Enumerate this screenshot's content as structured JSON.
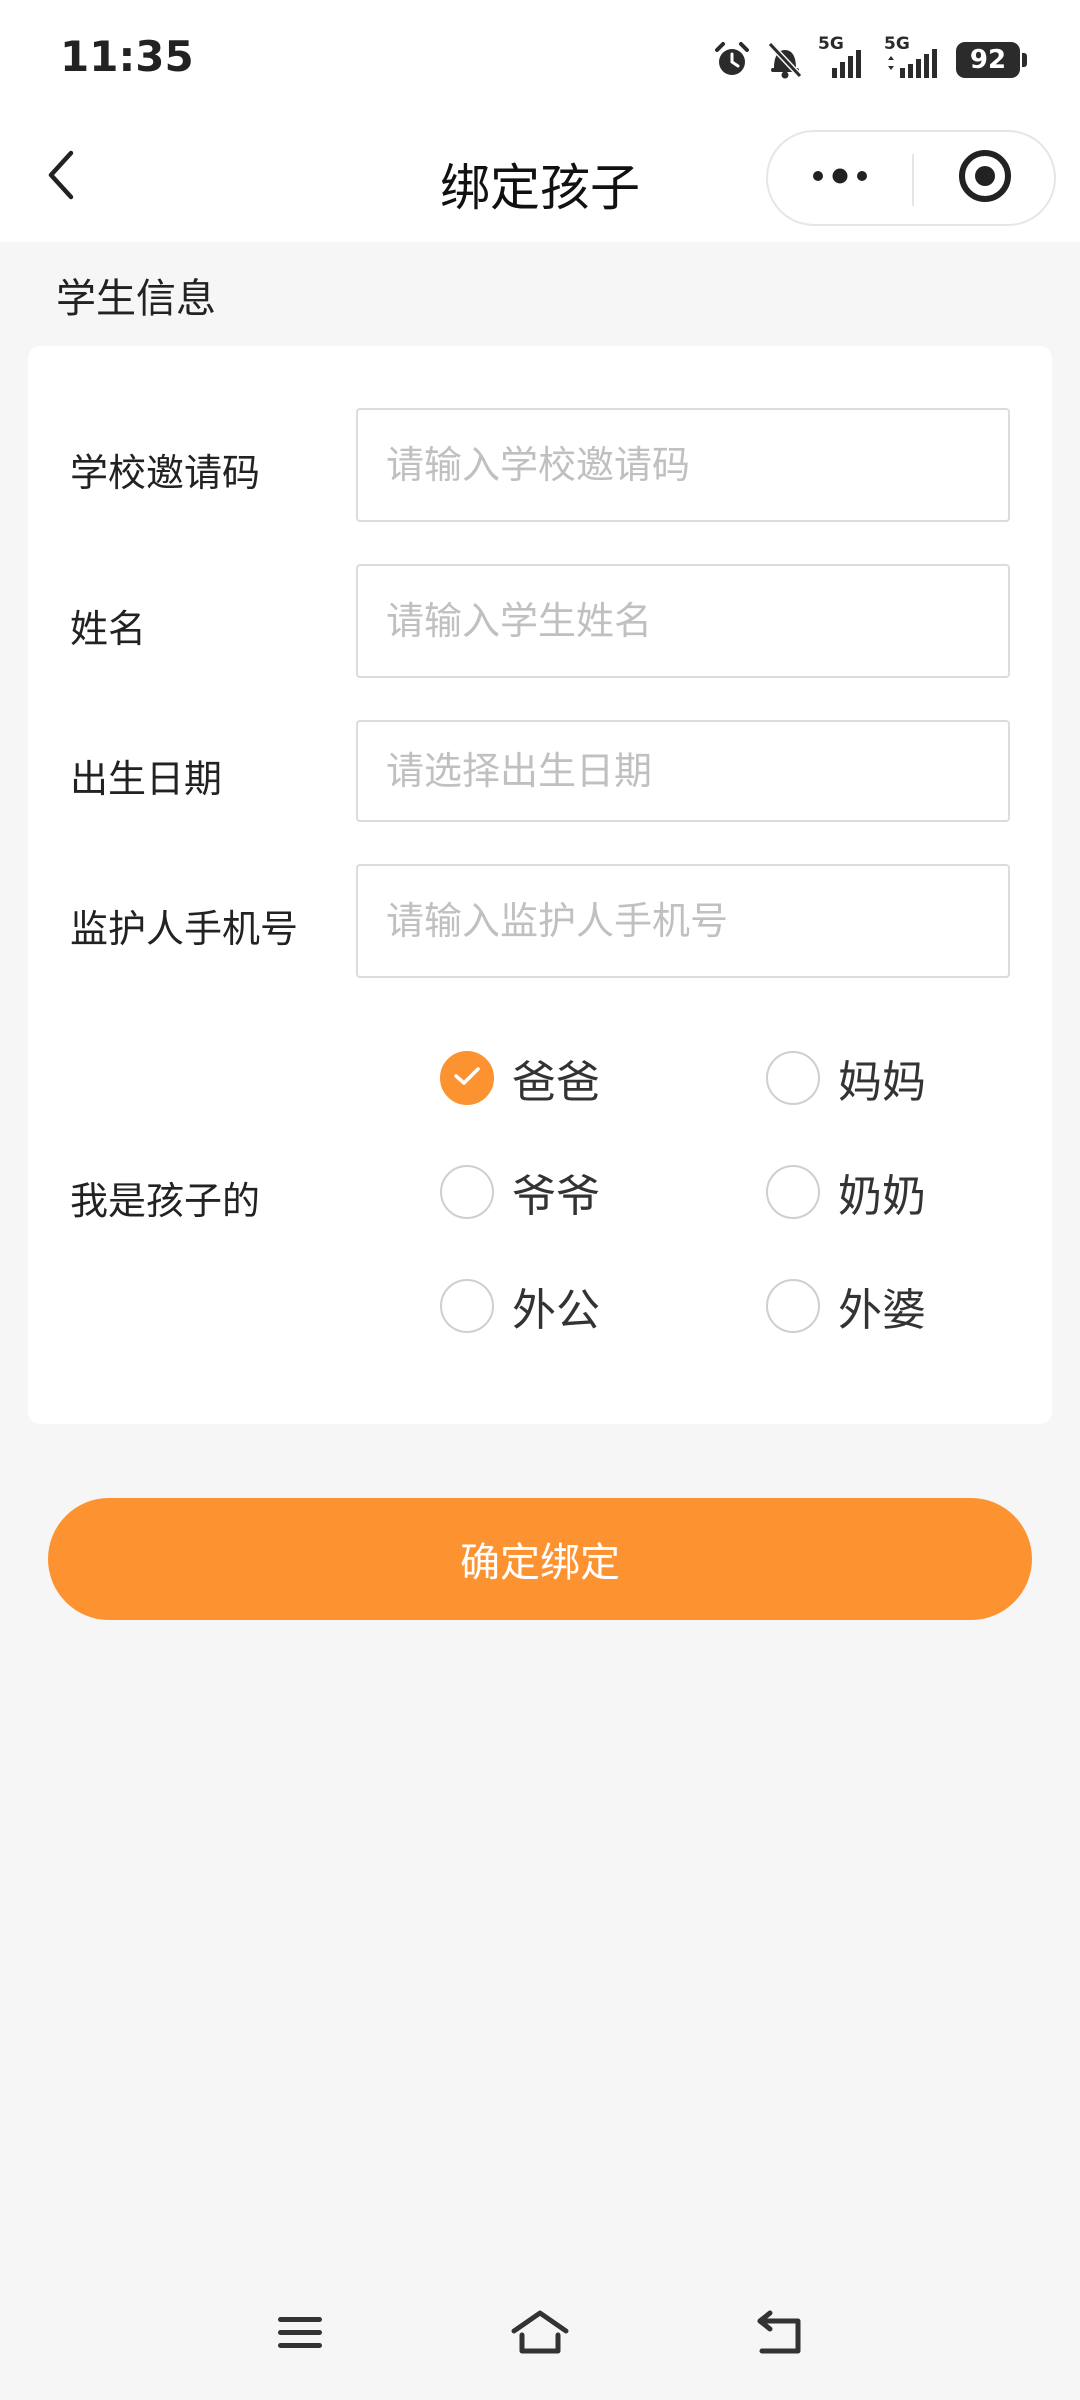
{
  "status_bar": {
    "time": "11:35",
    "network_1": "5G",
    "network_2": "5G",
    "battery": "92",
    "icons": [
      "alarm-icon",
      "bell-muted-icon",
      "signal-5g-icon",
      "signal-5g-icon",
      "battery-icon"
    ]
  },
  "nav": {
    "title": "绑定孩子",
    "back_icon": "chevron-left-icon",
    "more_icon": "more-dots-icon",
    "close_icon": "target-close-icon"
  },
  "section": {
    "title": "学生信息"
  },
  "form": {
    "school_code": {
      "label": "学校邀请码",
      "placeholder": "请输入学校邀请码",
      "value": ""
    },
    "name": {
      "label": "姓名",
      "placeholder": "请输入学生姓名",
      "value": ""
    },
    "birth_date": {
      "label": "出生日期",
      "placeholder": "请选择出生日期",
      "value": ""
    },
    "guardian_phone": {
      "label": "监护人手机号",
      "placeholder": "请输入监护人手机号",
      "value": ""
    },
    "relation": {
      "label": "我是孩子的",
      "selected": "爸爸",
      "options": [
        "爸爸",
        "妈妈",
        "爷爷",
        "奶奶",
        "外公",
        "外婆"
      ]
    }
  },
  "submit": {
    "label": "确定绑定"
  },
  "colors": {
    "accent": "#fd9330",
    "background": "#f6f6f6",
    "card": "#ffffff"
  },
  "system_nav": {
    "icons": [
      "menu-icon",
      "home-icon",
      "back-icon"
    ]
  }
}
